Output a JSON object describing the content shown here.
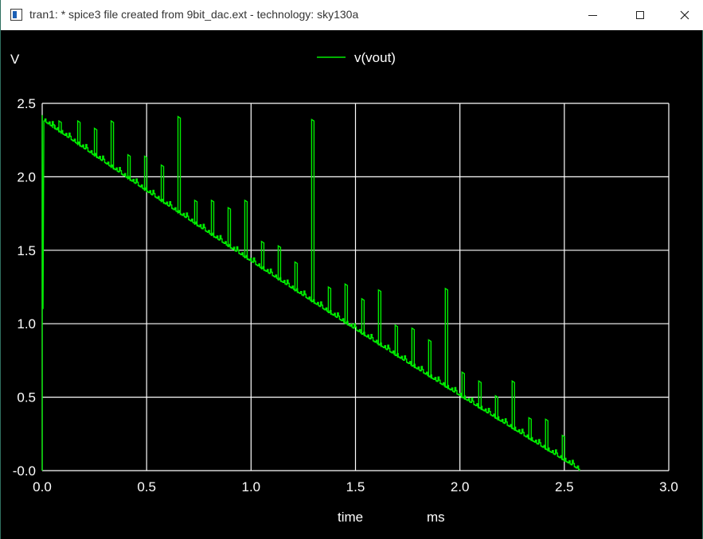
{
  "window": {
    "title": "tran1: * spice3 file created from 9bit_dac.ext - technology: sky130a",
    "icon": "app-window-icon",
    "controls": [
      "minimize-icon",
      "maximize-icon",
      "close-icon"
    ]
  },
  "colors": {
    "background": "#000000",
    "grid": "#ffffff",
    "trace": "#00ee00",
    "titlebar": "#ffffff"
  },
  "chart_data": {
    "type": "line",
    "title": "",
    "ylabel": "V",
    "xlabel": "time",
    "xunit": "ms",
    "xlim": [
      0.0,
      3.0
    ],
    "ylim": [
      0.0,
      2.5
    ],
    "xticks": [
      "0.0",
      "0.5",
      "1.0",
      "1.5",
      "2.0",
      "2.5",
      "3.0"
    ],
    "yticks": [
      "-0.0",
      "0.5",
      "1.0",
      "1.5",
      "2.0",
      "2.5"
    ],
    "grid": true,
    "legend_placement": "top-center",
    "series": [
      {
        "name": "v(vout)",
        "color": "#00ee00",
        "step_count": 512,
        "x_start": 0.0,
        "x_end": 2.57,
        "y_start": 2.38,
        "y_end": 0.0,
        "startup_spike": [
          [
            0.0,
            0.0
          ],
          [
            0.0,
            2.42
          ],
          [
            0.004,
            1.1
          ],
          [
            0.008,
            2.38
          ]
        ],
        "glitches": [
          [
            0.05,
            2.36
          ],
          [
            0.08,
            2.38
          ],
          [
            0.17,
            2.38
          ],
          [
            0.25,
            2.33
          ],
          [
            0.33,
            2.38
          ],
          [
            0.41,
            2.15
          ],
          [
            0.49,
            2.14
          ],
          [
            0.57,
            2.08
          ],
          [
            0.65,
            2.41
          ],
          [
            0.73,
            1.84
          ],
          [
            0.81,
            1.84
          ],
          [
            0.89,
            1.79
          ],
          [
            0.97,
            1.84
          ],
          [
            1.05,
            1.56
          ],
          [
            1.13,
            1.53
          ],
          [
            1.21,
            1.42
          ],
          [
            1.29,
            2.39
          ],
          [
            1.37,
            1.25
          ],
          [
            1.45,
            1.27
          ],
          [
            1.53,
            1.17
          ],
          [
            1.61,
            1.23
          ],
          [
            1.69,
            0.99
          ],
          [
            1.77,
            0.97
          ],
          [
            1.85,
            0.89
          ],
          [
            1.93,
            1.24
          ],
          [
            2.01,
            0.67
          ],
          [
            2.09,
            0.61
          ],
          [
            2.17,
            0.51
          ],
          [
            2.25,
            0.61
          ],
          [
            2.33,
            0.36
          ],
          [
            2.41,
            0.35
          ],
          [
            2.49,
            0.24
          ]
        ]
      }
    ]
  }
}
